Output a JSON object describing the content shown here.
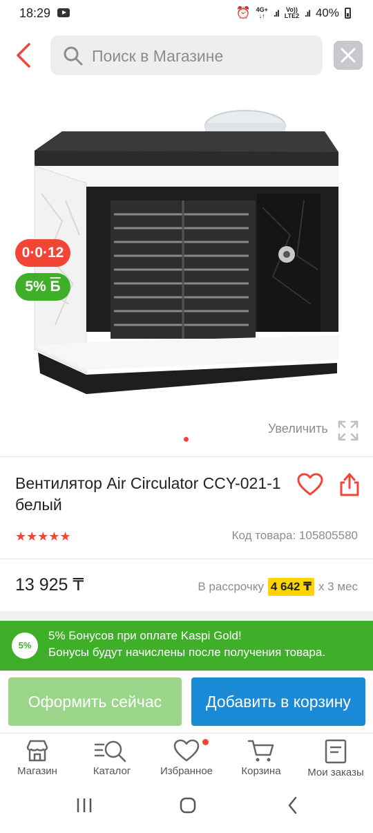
{
  "status_bar": {
    "time": "18:29",
    "network_top": "4G+",
    "volte_top": "Vo))",
    "volte_bottom": "LTE2",
    "battery": "40%"
  },
  "search": {
    "placeholder": "Поиск в Магазине"
  },
  "product": {
    "badge_installment": "0·0·12",
    "badge_bonus": "5%",
    "badge_bonus_unit": "Б",
    "zoom_label": "Увеличить",
    "title": "Вентилятор Air Circulator CCY-021-1 белый",
    "rating_stars": 5,
    "code_label": "Код товара: 105805580",
    "price": "13 925 ₸",
    "installment_prefix": "В рассрочку",
    "installment_amount": "4 642 ₸",
    "installment_suffix": "х 3 мес"
  },
  "bonus_banner": {
    "badge": "5%",
    "line1": "5% Бонусов при оплате Kaspi Gold!",
    "line2": "Бонусы будут начислены после получения товара."
  },
  "actions": {
    "buy_now": "Оформить сейчас",
    "add_to_cart": "Добавить в корзину"
  },
  "bottom_nav": {
    "items": [
      {
        "label": "Магазин"
      },
      {
        "label": "Каталог"
      },
      {
        "label": "Избранное"
      },
      {
        "label": "Корзина"
      },
      {
        "label": "Мои заказы"
      }
    ]
  },
  "colors": {
    "accent_red": "#f14635",
    "kaspi_green": "#3fae29",
    "cart_blue": "#1a8ad6",
    "buy_green_light": "#9bd58a",
    "highlight_yellow": "#ffd500"
  }
}
